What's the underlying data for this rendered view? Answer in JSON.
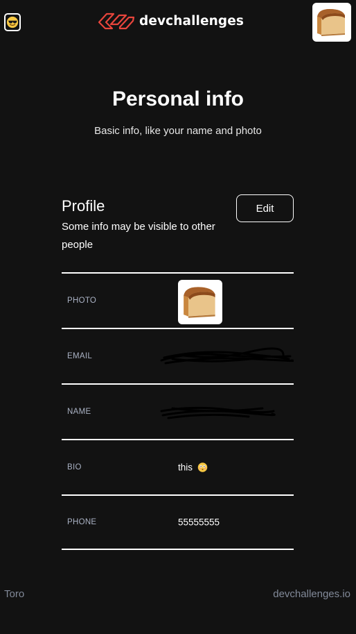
{
  "header": {
    "theme_icon": "sunglasses-face-icon",
    "logo_text": "devchallenges",
    "logo_icon": "devchallenges-logo-icon",
    "avatar_icon": "bread-loaf-icon",
    "brand_color": "#e8453c"
  },
  "intro": {
    "title": "Personal info",
    "subtitle": "Basic info, like your name and photo"
  },
  "profile": {
    "title": "Profile",
    "description": "Some info may be visible to other people",
    "edit_label": "Edit",
    "rows": [
      {
        "label": "PHOTO",
        "value_icon": "bread-loaf-icon"
      },
      {
        "label": "EMAIL",
        "value": "redacted-scribble"
      },
      {
        "label": "NAME",
        "value": "redacted-scribble"
      },
      {
        "label": "BIO",
        "value": "this",
        "value_icon": "flushed-face-emoji-icon"
      },
      {
        "label": "PHONE",
        "value": "55555555"
      }
    ]
  },
  "footer": {
    "left": "Toro",
    "right": "devchallenges.io"
  }
}
